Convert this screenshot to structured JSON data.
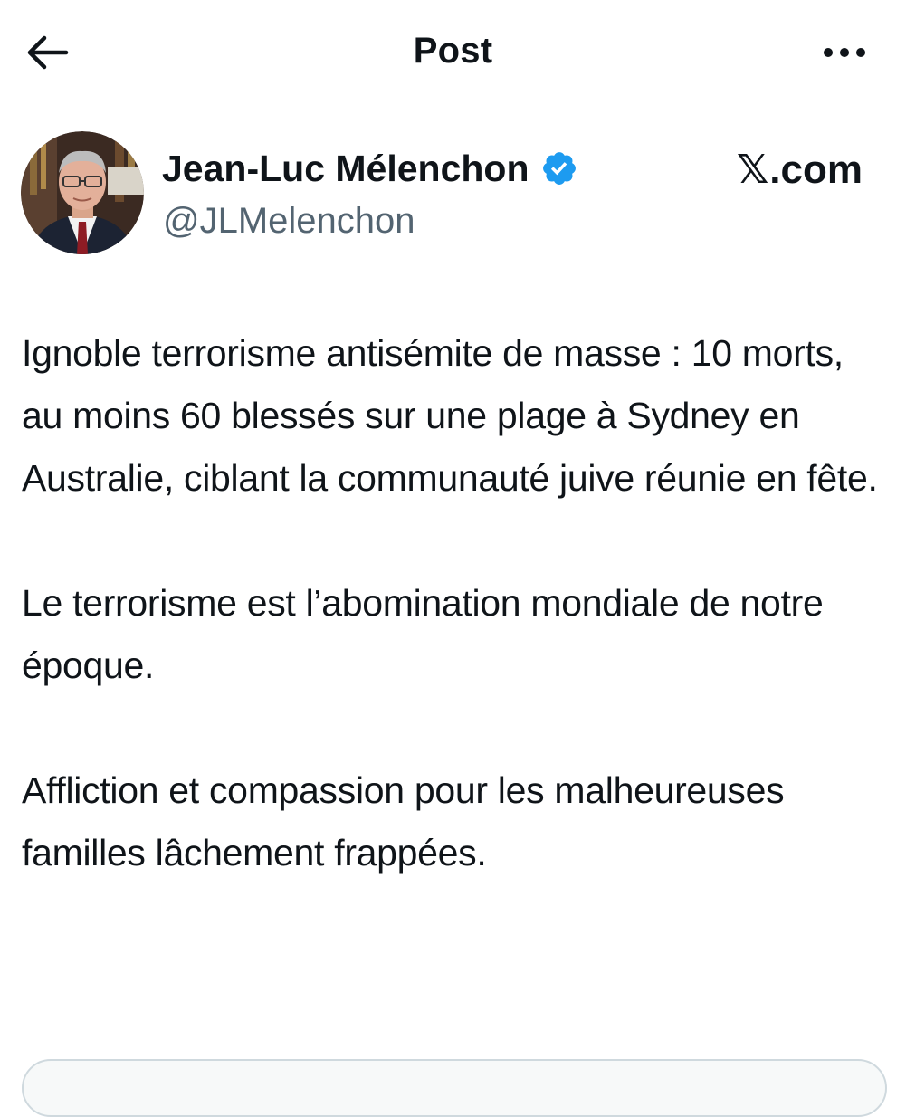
{
  "header": {
    "title": "Post",
    "back_icon": "arrow-left-icon",
    "more_icon": "more-horizontal-icon"
  },
  "author": {
    "display_name": "Jean-Luc Mélenchon",
    "handle": "@JLMelenchon",
    "verified": true,
    "verified_color": "#1d9bf0",
    "avatar_icon": "avatar-photo"
  },
  "brand": {
    "logo_glyph": "𝕏",
    "label": ".com"
  },
  "tweet": {
    "paragraphs": [
      "Ignoble terrorisme antisémite de masse : 10 morts, au moins 60 blessés sur une plage à Sydney en Australie, ciblant la communauté juive réunie en fête.",
      "Le terrorisme est l’abomination mondiale de notre époque.",
      "Affliction et compassion pour les malheureuses familles lâchement frappées."
    ]
  },
  "colors": {
    "text": "#0f1419",
    "secondary_text": "#536471",
    "accent": "#1d9bf0"
  }
}
